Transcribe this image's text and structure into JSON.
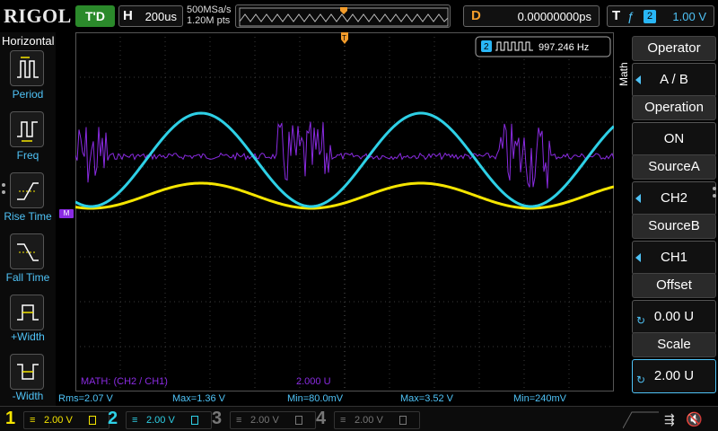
{
  "header": {
    "brand": "RIGOL",
    "run_state": "T'D",
    "timebase_key": "H",
    "timebase_value": "200us",
    "sample_rate": "500MSa/s",
    "memory_depth": "1.20M pts",
    "delay_key": "D",
    "delay_value": "0.00000000ps",
    "trigger_key": "T",
    "trigger_edge_icon": "rising-edge-icon",
    "trigger_source": "2",
    "trigger_level": "1.00 V"
  },
  "left_panel": {
    "title": "Horizontal",
    "items": [
      {
        "label": "Period",
        "icon": "period-icon"
      },
      {
        "label": "Freq",
        "icon": "frequency-icon"
      },
      {
        "label": "Rise Time",
        "icon": "rise-time-icon"
      },
      {
        "label": "Fall Time",
        "icon": "fall-time-icon"
      },
      {
        "label": "+Width",
        "icon": "positive-width-icon"
      },
      {
        "label": "-Width",
        "icon": "negative-width-icon"
      }
    ]
  },
  "screen": {
    "freq_badge_channel": "2",
    "freq_badge_value": "997.246 Hz",
    "math_label": "MATH: (CH2 / CH1)",
    "math_scale": "2.000 U",
    "math_marker": "M",
    "trigger_marker": "T"
  },
  "right_panel": {
    "menu_title": "Math",
    "sections": [
      {
        "head": "Operator",
        "value": "A / B"
      },
      {
        "head": "Operation",
        "value": "ON"
      },
      {
        "head": "SourceA",
        "value": "CH2"
      },
      {
        "head": "SourceB",
        "value": "CH1"
      },
      {
        "head": "Offset",
        "value": "0.00 U"
      },
      {
        "head": "Scale",
        "value": "2.00 U"
      }
    ]
  },
  "measurements": [
    "Rms=2.07 V",
    "Max=1.36 V",
    "Min=80.0mV",
    "Max=3.52 V",
    "Min=240mV"
  ],
  "channels": [
    {
      "num": "1",
      "coupling": "≡",
      "scale": "2.00 V",
      "color": "#f5e500"
    },
    {
      "num": "2",
      "coupling": "≡",
      "scale": "2.00 V",
      "color": "#2ed0e6"
    },
    {
      "num": "3",
      "coupling": "≡",
      "scale": "2.00 V",
      "color": "#777777"
    },
    {
      "num": "4",
      "coupling": "≡",
      "scale": "2.00 V",
      "color": "#777777"
    }
  ],
  "colors": {
    "ch1": "#f5e500",
    "ch2": "#2ed0e6",
    "math": "#8a2be2",
    "trigger": "#f39c2b",
    "accent": "#4fc3f7"
  },
  "status_icons": [
    "usb-icon",
    "speaker-muted-icon"
  ]
}
